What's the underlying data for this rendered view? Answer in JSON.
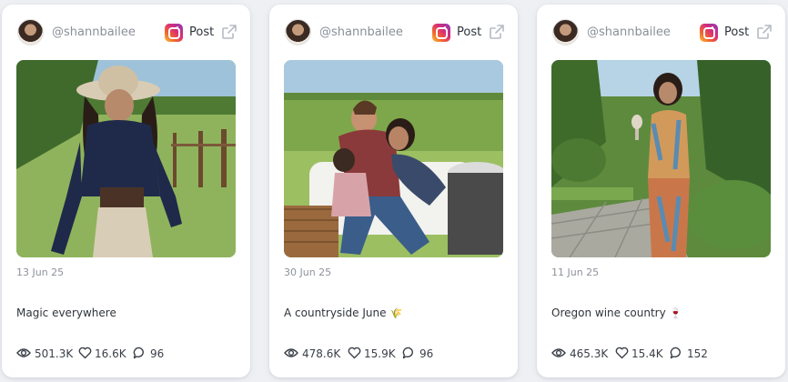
{
  "cards": [
    {
      "handle": "@shannbailee",
      "platform_label": "Post",
      "date": "13 Jun 25",
      "caption": "Magic everywhere",
      "caption_emoji": "",
      "views": "501.3K",
      "likes": "16.6K",
      "comments": "96"
    },
    {
      "handle": "@shannbailee",
      "platform_label": "Post",
      "date": "30 Jun 25",
      "caption": "A countryside June",
      "caption_emoji": "🌾",
      "views": "478.6K",
      "likes": "15.9K",
      "comments": "96"
    },
    {
      "handle": "@shannbailee",
      "platform_label": "Post",
      "date": "11 Jun 25",
      "caption": "Oregon wine country",
      "caption_emoji": "🍷",
      "views": "465.3K",
      "likes": "15.4K",
      "comments": "152"
    }
  ],
  "icons": {
    "platform": "instagram-icon",
    "open_external": "external-link-icon",
    "views": "eye-icon",
    "likes": "heart-icon",
    "comments": "comment-icon"
  },
  "colors": {
    "background": "#eef0f4",
    "card": "#ffffff",
    "muted_text": "#8d929a"
  }
}
